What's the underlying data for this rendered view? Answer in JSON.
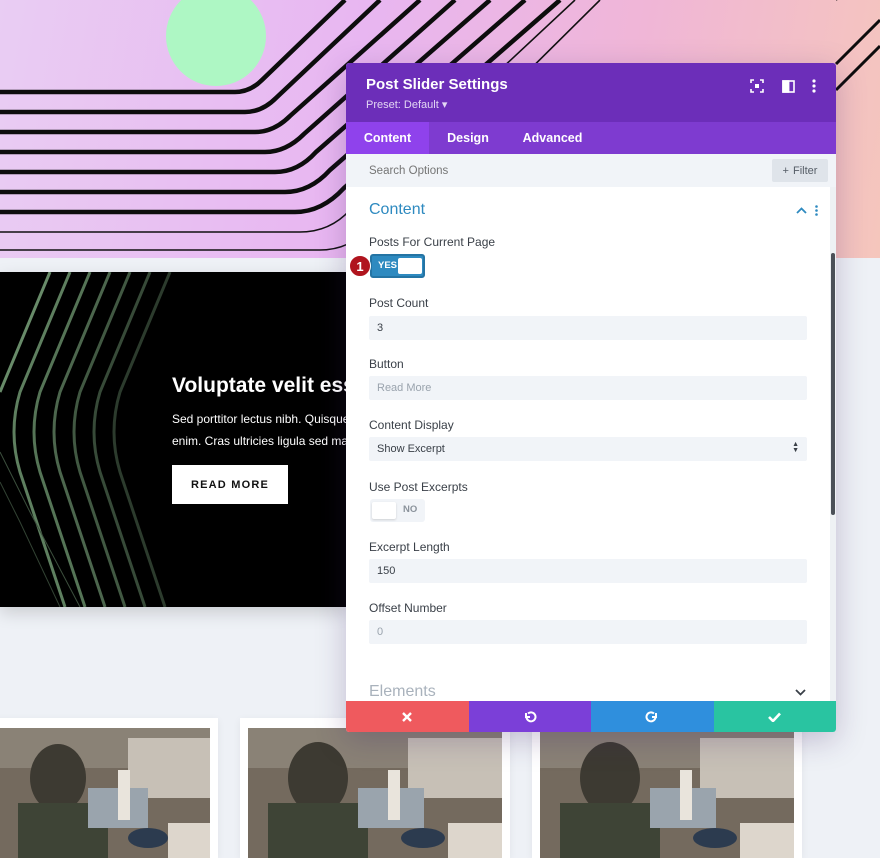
{
  "background": {
    "slide": {
      "title": "Voluptate velit ess",
      "text_lines": [
        "Sed porttitor lectus nibh. Quisque",
        "enim. Cras ultricies ligula sed mag"
      ],
      "button_label": "READ MORE"
    }
  },
  "modal": {
    "title": "Post Slider Settings",
    "preset": "Preset: Default ▾",
    "header_icons": [
      "expand-icon",
      "split-view-icon",
      "more-vertical-icon"
    ],
    "tabs": [
      {
        "label": "Content",
        "active": true
      },
      {
        "label": "Design",
        "active": false
      },
      {
        "label": "Advanced",
        "active": false
      }
    ],
    "search": {
      "placeholder": "Search Options"
    },
    "filter_label": "Filter",
    "section": {
      "title": "Content"
    },
    "fields": {
      "posts_for_current_page": {
        "label": "Posts For Current Page",
        "value": "YES",
        "on": true
      },
      "post_count": {
        "label": "Post Count",
        "value": "3"
      },
      "button": {
        "label": "Button",
        "placeholder": "Read More"
      },
      "content_display": {
        "label": "Content Display",
        "value": "Show Excerpt"
      },
      "use_post_excerpts": {
        "label": "Use Post Excerpts",
        "value": "NO",
        "on": false
      },
      "excerpt_length": {
        "label": "Excerpt Length",
        "value": "150"
      },
      "offset_number": {
        "label": "Offset Number",
        "placeholder": "0"
      }
    },
    "elements_title": "Elements",
    "badge": "1",
    "footer": [
      {
        "name": "cancel",
        "glyph": "✖",
        "color": "#ef5a5e"
      },
      {
        "name": "undo",
        "glyph": "↶",
        "color": "#7b3fd8"
      },
      {
        "name": "redo",
        "glyph": "↷",
        "color": "#2f8fdd"
      },
      {
        "name": "save",
        "glyph": "✔",
        "color": "#29c4a1"
      }
    ]
  },
  "colors": {
    "header": "#6c2eb9",
    "tabs": "#7e3bd0",
    "accent": "#2e8ac0"
  }
}
